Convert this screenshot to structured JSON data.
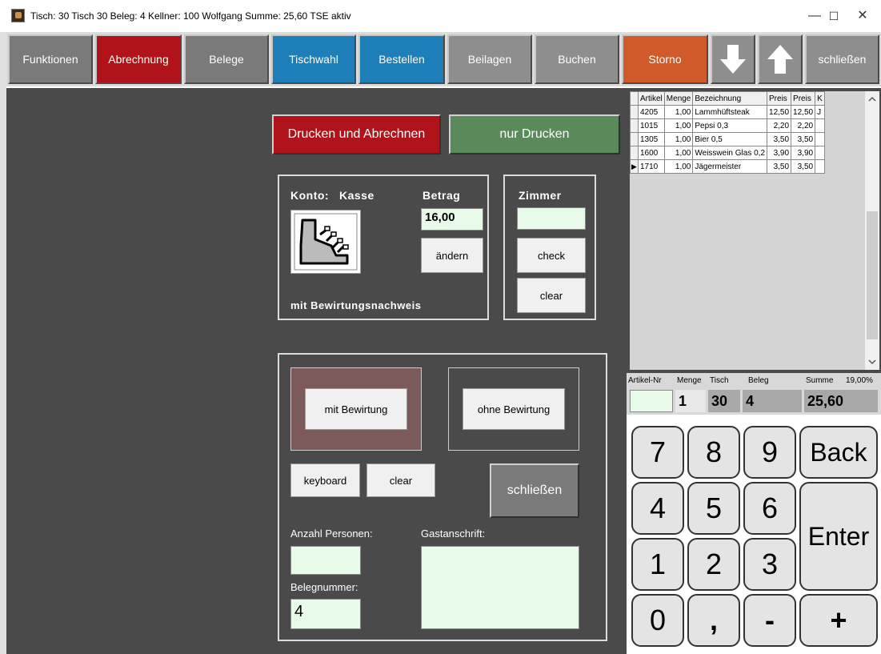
{
  "window": {
    "title": "Tisch: 30 Tisch 30  Beleg: 4  Kellner: 100 Wolfgang  Summe: 25,60  TSE aktiv",
    "minimize": "—",
    "maximize": "☐",
    "close": "✕"
  },
  "toolbar": {
    "funktionen": "Funktionen",
    "abrechnung": "Abrechnung",
    "belege": "Belege",
    "tischwahl": "Tischwahl",
    "bestellen": "Bestellen",
    "beilagen": "Beilagen",
    "buchen": "Buchen",
    "storno": "Storno",
    "schliessen": "schließen"
  },
  "actions": {
    "drucken_abrechnen": "Drucken und Abrechnen",
    "nur_drucken": "nur Drucken"
  },
  "konto": {
    "label": "Konto:",
    "value": "Kasse",
    "betrag_label": "Betrag",
    "betrag_value": "16,00",
    "aendern": "ändern",
    "bewirtungsnachweis": "mit Bewirtungsnachweis"
  },
  "zimmer": {
    "label": "Zimmer",
    "value": "",
    "check": "check",
    "clear": "clear"
  },
  "bewirtung": {
    "mit": "mit Bewirtung",
    "ohne": "ohne Bewirtung",
    "keyboard": "keyboard",
    "clear": "clear",
    "schliessen": "schließen",
    "anzahl_label": "Anzahl Personen:",
    "anzahl_value": "",
    "gast_label": "Gastanschrift:",
    "gast_value": "",
    "belegnr_label": "Belegnummer:",
    "belegnr_value": "4"
  },
  "grid": {
    "headers": [
      "Artikel",
      "Menge",
      "Bezeichnung",
      "Preis",
      "Preis",
      "K"
    ],
    "rows": [
      [
        "4205",
        "1,00",
        "Lammhüftsteak",
        "12,50",
        "12,50",
        "J"
      ],
      [
        "1015",
        "1,00",
        "Pepsi 0,3",
        "2,20",
        "2,20",
        ""
      ],
      [
        "1305",
        "1,00",
        "Bier 0,5",
        "3,50",
        "3,50",
        ""
      ],
      [
        "1600",
        "1,00",
        "Weisswein Glas 0,2",
        "3,90",
        "3,90",
        ""
      ],
      [
        "1710",
        "1,00",
        "Jägermeister",
        "3,50",
        "3,50",
        ""
      ]
    ],
    "current_row_marker": "▶"
  },
  "info": {
    "artikelnr_label": "Artikel-Nr",
    "menge_label": "Menge",
    "tisch_label": "Tisch",
    "beleg_label": "Beleg",
    "summe_label": "Summe",
    "mwst_label": "19,00%",
    "artikelnr_value": "",
    "menge_value": "1",
    "tisch_value": "30",
    "beleg_value": "4",
    "summe_value": "25,60"
  },
  "keypad": {
    "k7": "7",
    "k8": "8",
    "k9": "9",
    "back": "Back",
    "k4": "4",
    "k5": "5",
    "k6": "6",
    "enter": "Enter",
    "k1": "1",
    "k2": "2",
    "k3": "3",
    "k0": "0",
    "comma": ",",
    "minus": "-",
    "plus": "+"
  },
  "colors": {
    "accent_red": "#b0141a",
    "accent_blue": "#1e7fb8",
    "accent_orange": "#d05a2a",
    "accent_green": "#5a8a5a",
    "field_green": "#e8fbe8",
    "background_dark": "#4a4a4a"
  },
  "icons": {
    "app": "app-icon",
    "arrow_down": "arrow-down-icon",
    "arrow_up": "arrow-up-icon",
    "cash_register": "cash-register-icon"
  }
}
